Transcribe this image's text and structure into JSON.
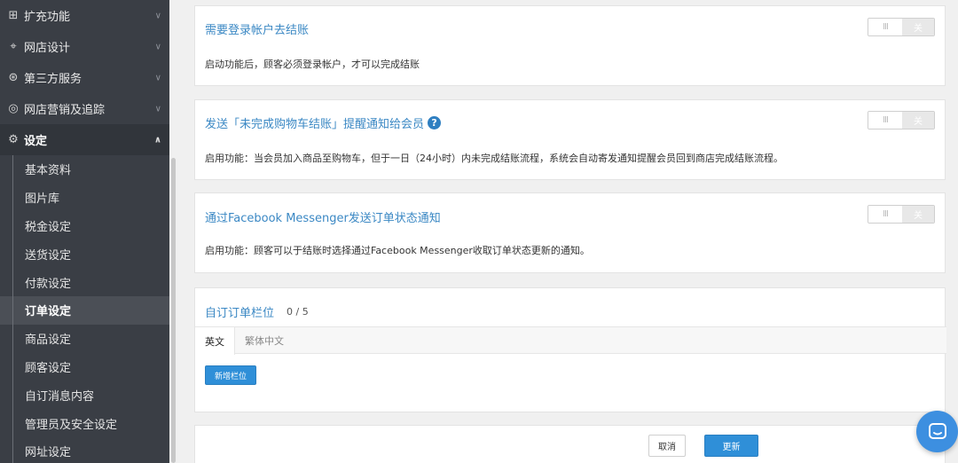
{
  "sidebar": {
    "top_items": [
      {
        "label": "扩充功能",
        "icon": "grid-plus-icon"
      },
      {
        "label": "网店设计",
        "icon": "paint-roller-icon"
      },
      {
        "label": "第三方服务",
        "icon": "puzzle-circles-icon"
      },
      {
        "label": "网店营销及追踪",
        "icon": "target-icon"
      },
      {
        "label": "设定",
        "icon": "gear-icon"
      }
    ],
    "sub_items": [
      {
        "label": "基本资料"
      },
      {
        "label": "图片库"
      },
      {
        "label": "税金设定"
      },
      {
        "label": "送货设定"
      },
      {
        "label": "付款设定"
      },
      {
        "label": "订单设定"
      },
      {
        "label": "商品设定"
      },
      {
        "label": "顾客设定"
      },
      {
        "label": "自订消息内容"
      },
      {
        "label": "管理员及安全设定"
      },
      {
        "label": "网址设定"
      }
    ],
    "selected_sub": "订单设定"
  },
  "cards": [
    {
      "title": "需要登录帐户去结账",
      "desc": "启动功能后，顾客必须登录帐户，才可以完成结账",
      "toggle_off_label": "关",
      "toggle_bars": "III"
    },
    {
      "title": "发送「未完成购物车结账」提醒通知给会员",
      "desc": "启用功能：当会员加入商品至购物车，但于一日（24小时）内未完成结账流程，系统会自动寄发通知提醒会员回到商店完成结账流程。",
      "toggle_off_label": "关",
      "toggle_bars": "III",
      "help_icon": "?"
    },
    {
      "title": "通过Facebook Messenger发送订单状态通知",
      "desc": "启用功能：顾客可以于结账时选择通过Facebook Messenger收取订单状态更新的通知。",
      "toggle_off_label": "关",
      "toggle_bars": "III"
    }
  ],
  "custom_fields": {
    "title": "自订订单栏位",
    "count": "0 / 5",
    "tabs": [
      {
        "label": "英文"
      },
      {
        "label": "繁体中文"
      }
    ],
    "add_button": "新增栏位"
  },
  "footer": {
    "cancel": "取消",
    "save": "更新"
  },
  "colors": {
    "sidebar_bg": "#3a3e45",
    "link_blue": "#3b88c4",
    "primary_button": "#2f8fd8",
    "chat_bubble": "#3d8fe0"
  }
}
